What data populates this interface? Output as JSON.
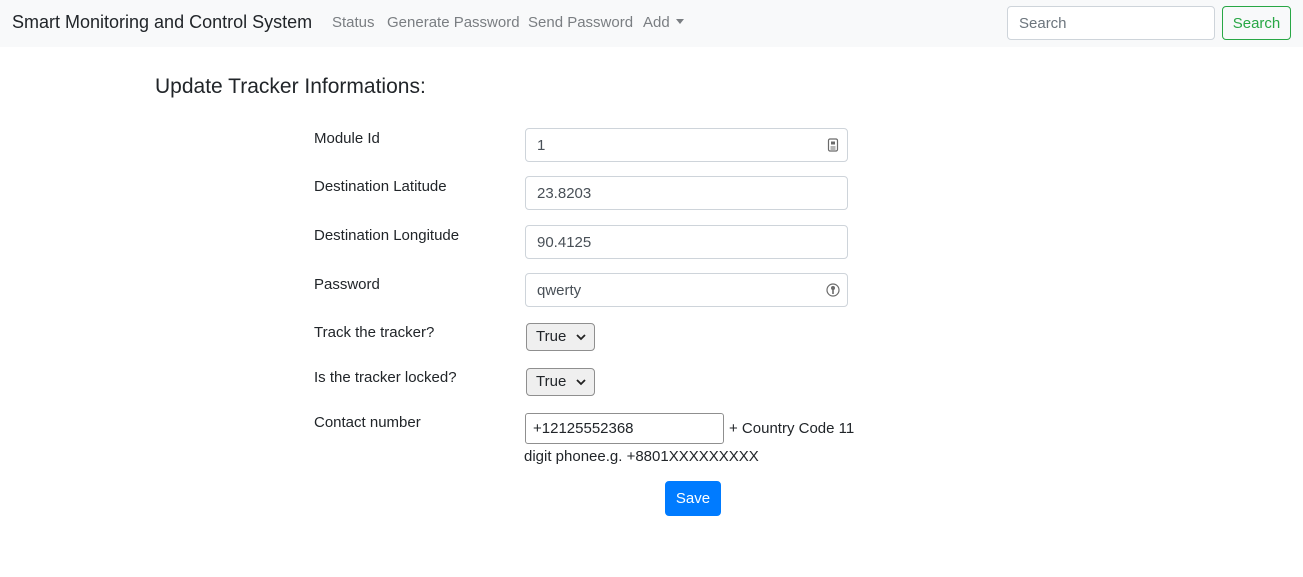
{
  "navbar": {
    "brand": "Smart Monitoring and Control System",
    "links": [
      {
        "label": "Status"
      },
      {
        "label": "Generate Password"
      },
      {
        "label": "Send Password"
      },
      {
        "label": "Add"
      }
    ],
    "search": {
      "placeholder": "Search",
      "value": "",
      "button_label": "Search"
    }
  },
  "form": {
    "title": "Update Tracker Informations:",
    "module_id": {
      "label": "Module Id",
      "value": "1"
    },
    "latitude": {
      "label": "Destination Latitude",
      "value": "23.8203"
    },
    "longitude": {
      "label": "Destination Longitude",
      "value": "90.4125"
    },
    "password": {
      "label": "Password",
      "value": "qwerty"
    },
    "track": {
      "label": "Track the tracker?",
      "value": "True"
    },
    "locked": {
      "label": "Is the tracker locked?",
      "value": "True"
    },
    "contact": {
      "label": "Contact number",
      "value": "+12125552368",
      "hint_line1": "+ Country Code 11",
      "hint_line2": "digit phonee.g. +8801XXXXXXXXX"
    },
    "save_label": "Save"
  },
  "colors": {
    "navbar_bg": "#f8f9fa",
    "success": "#28a745",
    "primary": "#007bff"
  },
  "icons": {
    "dropdown": "chevron-down-icon",
    "module_id_field": "id-card-icon",
    "password_field": "key-icon"
  }
}
